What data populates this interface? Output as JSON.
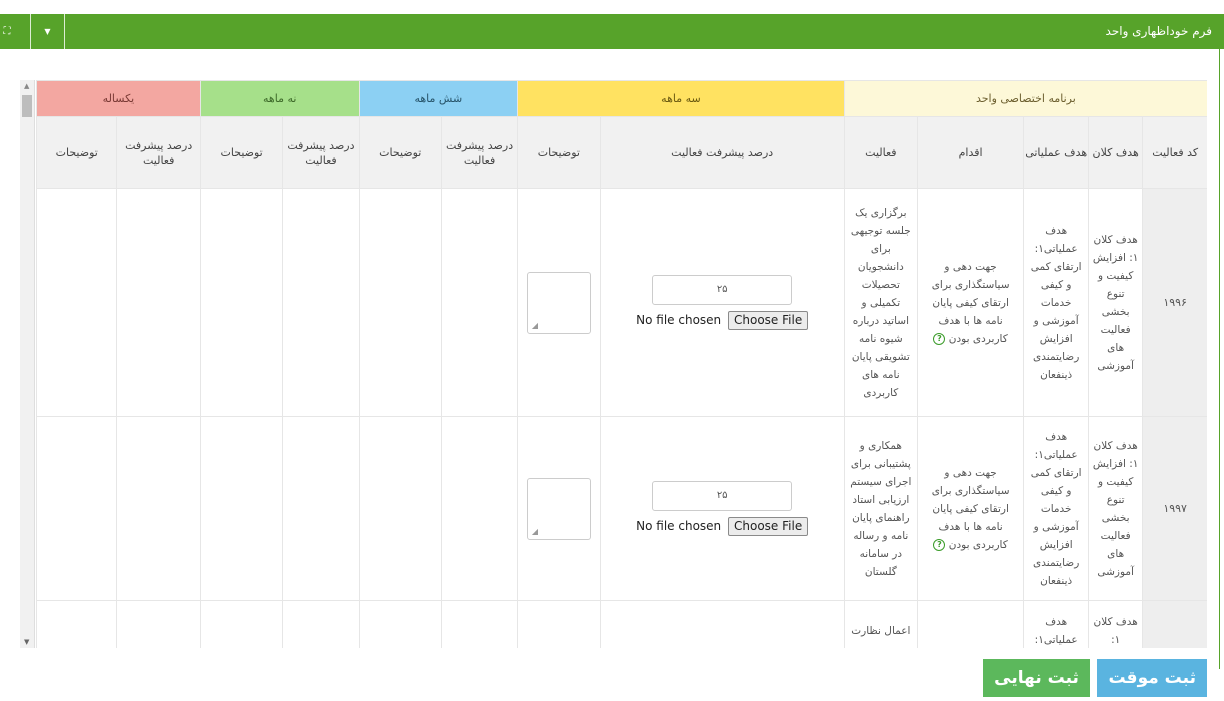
{
  "topbar": {
    "title": "فرم خوداظهاری واحد",
    "collapse_icon": "caret-down-icon",
    "expand_icon": "expand-icon"
  },
  "bands": {
    "special": "برنامه اختصاصی واحد",
    "three": "سه ماهه",
    "six": "شش ماهه",
    "nine": "نه ماهه",
    "year": "یکساله"
  },
  "headers": {
    "code": "کد فعالیت",
    "macro": "هدف کلان",
    "operational": "هدف عملیاتی",
    "action": "اقدام",
    "activity": "فعالیت",
    "progress_percent": "درصد پیشرفت فعالیت",
    "comments": "توضیحات",
    "progress_short": "درصد پیشرفت فعالیت"
  },
  "rows": [
    {
      "code": "۱۹۹۶",
      "macro": "هدف کلان ۱: افزایش کیفیت و تنوع بخشی فعالیت های آموزشی",
      "operational": "هدف عملیاتی۱: ارتقای کمی و کیفی خدمات آموزشی و افزایش رضایتمندی ذینفعان",
      "action": "جهت دهی و سیاستگذاری برای ارتقای کیفی پایان نامه ها با هدف کاربردی بودن",
      "activity": "برگزاری یک جلسه توجیهی برای دانشجویان تحصیلات تکمیلی و اساتید درباره شیوه نامه تشویقی پایان نامه های کاربردی",
      "progress": "۲۵",
      "file_status": "No file chosen",
      "file_button": "Choose File"
    },
    {
      "code": "۱۹۹۷",
      "macro": "هدف کلان ۱: افزایش کیفیت و تنوع بخشی فعالیت های آموزشی",
      "operational": "هدف عملیاتی۱: ارتقای کمی و کیفی خدمات آموزشی و افزایش رضایتمندی ذینفعان",
      "action": "جهت دهی و سیاستگذاری برای ارتقای کیفی پایان نامه ها با هدف کاربردی بودن",
      "activity": "همکاری و پشتیبانی برای اجرای سیستم ارزیابی استاد راهنمای پایان نامه و رساله در سامانه گلستان",
      "progress": "۲۵",
      "file_status": "No file chosen",
      "file_button": "Choose File"
    },
    {
      "macro": "هدف کلان ۱:",
      "operational": "هدف عملیاتی۱:",
      "activity": "اعمال نظارت"
    }
  ],
  "icons": {
    "help": "help-circle-icon",
    "help_glyph": "?",
    "scroll_up": "▲",
    "scroll_down": "▼"
  },
  "actions": {
    "temp_save": "ثبت موقت",
    "final_save": "ثبت نهایی"
  },
  "colors": {
    "topbar": "#57a32a",
    "band_special": "#fdf8d8",
    "band_three": "#ffe261",
    "band_six": "#8cd0f3",
    "band_nine": "#a6e08a",
    "band_year": "#f3a7a1",
    "btn_temp": "#5ab4e0",
    "btn_final": "#5cb85c"
  }
}
